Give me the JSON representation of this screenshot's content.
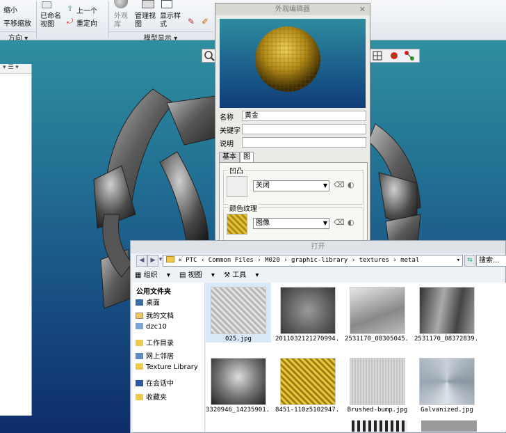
{
  "ribbon": {
    "zoom_out": "缩小",
    "pan_zoom": "平移缩放",
    "saved_view": "已命名\n视图",
    "prev": "上一个",
    "reorient": "重定向",
    "appearance_lib": "外观\n库",
    "manage_view": "管理视\n图",
    "display_style": "显示样\n式",
    "group_orientation": "方向",
    "group_model_display": "模型显示"
  },
  "editor": {
    "title": "外观编辑器",
    "name_label": "名称",
    "name_value": "黄金",
    "keywords_label": "关键字",
    "keywords_value": "",
    "desc_label": "说明",
    "desc_value": "",
    "tab_basic": "基本",
    "tab_map": "图",
    "bump_legend": "凹凸",
    "bump_value": "关闭",
    "color_tex_legend": "颜色纹理",
    "color_tex_value": "图像"
  },
  "dialog": {
    "title": "打开",
    "path": [
      "PTC",
      "Common Files",
      "M020",
      "graphic-library",
      "textures",
      "metal"
    ],
    "search_placeholder": "搜索...",
    "toolbar": [
      "组织",
      "视图",
      "工具"
    ],
    "nav_header": "公用文件夹",
    "nav_items": [
      "桌面",
      "我的文档",
      "dzc10",
      "工作目录",
      "网上邻居",
      "Texture Library",
      "在会话中",
      "收藏夹"
    ],
    "files": [
      {
        "name": "025.jpg",
        "tex": "diamond"
      },
      {
        "name": "2011032121270994...",
        "tex": "brushed-radial"
      },
      {
        "name": "2531170_08305045...",
        "tex": "grain"
      },
      {
        "name": "2531170_08372839...",
        "tex": "streak"
      },
      {
        "name": "3320946_14235901...",
        "tex": "blur"
      },
      {
        "name": "8451-110z5102947...",
        "tex": "gold-plate"
      },
      {
        "name": "Brushed-bump.jpg",
        "tex": "brushed-bump"
      },
      {
        "name": "Galvanized.jpg",
        "tex": "galvanized"
      }
    ]
  },
  "colors": {
    "gold": "#c9a52c",
    "viewport_top": "#2f8fa0",
    "viewport_bottom": "#0e2d6a"
  }
}
